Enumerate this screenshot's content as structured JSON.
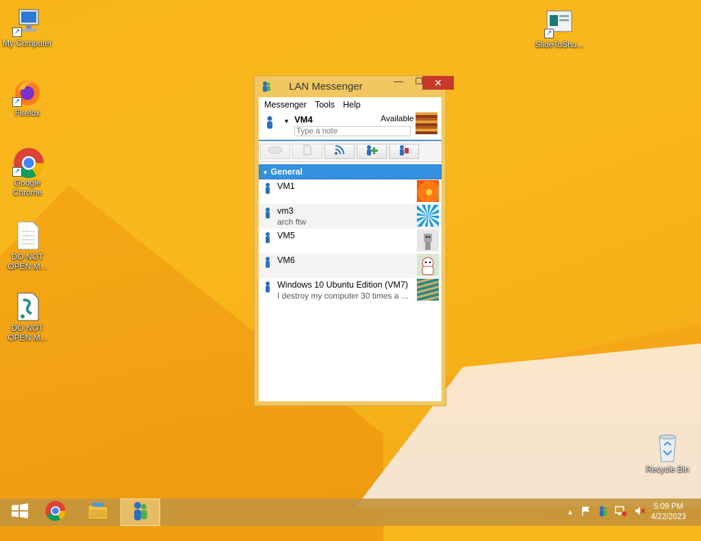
{
  "desktop": {
    "icons": [
      {
        "label": "My Computer"
      },
      {
        "label": "Firefox"
      },
      {
        "label": "Google Chrome"
      },
      {
        "label": "DO NOT OPEN M..."
      },
      {
        "label": "DO NOT OPEN M..."
      },
      {
        "label": "SlideToShu..."
      },
      {
        "label": "Recycle Bin"
      }
    ]
  },
  "window": {
    "title": "LAN Messenger",
    "controls": {
      "minimize": "—",
      "maximize": "☐",
      "close": "✕"
    },
    "menu": [
      "Messenger",
      "Tools",
      "Help"
    ],
    "user": {
      "name": "VM4",
      "status": "Available",
      "note_placeholder": "Type a note"
    },
    "toolbar": [
      {
        "icon": "chat-bubble-icon",
        "enabled": false
      },
      {
        "icon": "file-icon",
        "enabled": false
      },
      {
        "icon": "broadcast-icon",
        "enabled": true
      },
      {
        "icon": "add-contact-icon",
        "enabled": true
      },
      {
        "icon": "tools-icon",
        "enabled": true
      }
    ],
    "group": {
      "name": "General"
    },
    "contacts": [
      {
        "name": "VM1",
        "note": ""
      },
      {
        "name": "vm3",
        "note": "arch ftw"
      },
      {
        "name": "VM5",
        "note": ""
      },
      {
        "name": "VM6",
        "note": ""
      },
      {
        "name": "Windows 10 Ubuntu Edition (VM7)",
        "note": "I destroy my computer 30 times a d..."
      }
    ]
  },
  "taskbar": {
    "clock_time": "5:09 PM",
    "clock_date": "4/22/2023"
  },
  "colors": {
    "accent_blue": "#3391e0",
    "close_red": "#c7382b",
    "window_frame": "#f2c760"
  }
}
